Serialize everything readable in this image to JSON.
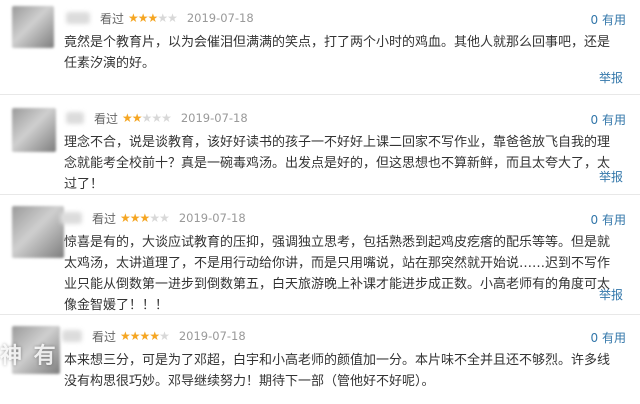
{
  "reviews": [
    {
      "watched": "看过",
      "rating": 3,
      "date": "2019-07-18",
      "useful": "0 有用",
      "content": "竟然是个教育片，以为会催泪但满满的笑点，打了两个小时的鸡血。其他人就那么回事吧，还是任素汐演的好。",
      "report": "举报"
    },
    {
      "watched": "看过",
      "rating": 2,
      "date": "2019-07-18",
      "useful": "0 有用",
      "content": "理念不合，说是谈教育，该好好读书的孩子一不好好上课二回家不写作业，靠爸爸放飞自我的理念就能考全校前十？真是一碗毒鸡汤。出发点是好的，但这思想也不算新鲜，而且太夸大了，太过了！",
      "report": "举报"
    },
    {
      "watched": "看过",
      "rating": 3,
      "date": "2019-07-18",
      "useful": "0 有用",
      "content": "惊喜是有的，大谈应试教育的压抑，强调独立思考，包括熟悉到起鸡皮疙瘩的配乐等等。但是就太鸡汤，太讲道理了，不是用行动给你讲，而是只用嘴说，站在那突然就开始说……迟到不写作业只能从倒数第一进步到倒数第五，白天旅游晚上补课才能进步成正数。小高老师有的角度可太像金智媛了！！！",
      "report": "举报"
    },
    {
      "watched": "看过",
      "rating": 4,
      "date": "2019-07-18",
      "useful": "0 有用",
      "content": "本来想三分，可是为了邓超，白宇和小高老师的颜值加一分。本片味不全并且还不够烈。许多线没有构思很巧妙。邓导继续努力！期待下一部（管他好不好呢）。",
      "report": "举报"
    }
  ],
  "watermark": "神 有",
  "colors": {
    "link": "#3377aa",
    "star_on": "#f5a623",
    "star_off": "#d8d8d8"
  }
}
